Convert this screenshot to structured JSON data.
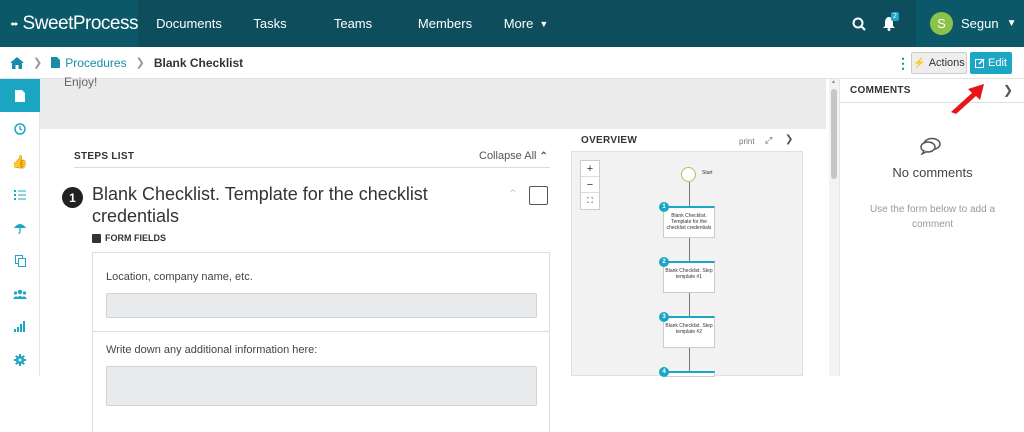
{
  "brand": {
    "name": "SweetProcess"
  },
  "nav": {
    "items": [
      {
        "label": "Documents"
      },
      {
        "label": "Tasks"
      },
      {
        "label": "Teams"
      },
      {
        "label": "Members"
      },
      {
        "label": "More"
      }
    ],
    "notification_count": "2",
    "user": {
      "initial": "S",
      "name": "Segun"
    }
  },
  "breadcrumb": {
    "items": [
      {
        "label": "Procedures"
      },
      {
        "label": "Blank Checklist"
      }
    ]
  },
  "toolbar": {
    "actions_label": "Actions",
    "edit_label": "Edit"
  },
  "content": {
    "intro_text": "Enjoy!"
  },
  "steps": {
    "header": "STEPS LIST",
    "collapse_label": "Collapse All",
    "step1": {
      "number": "1",
      "title": "Blank Checklist. Template for the checklist credentials",
      "form_fields_label": "FORM FIELDS",
      "fields": [
        {
          "label": "Location, company name, etc."
        },
        {
          "label": "Write down any additional information here:"
        }
      ]
    }
  },
  "overview": {
    "title": "OVERVIEW",
    "print_label": "print",
    "start_label": "Start",
    "nodes": [
      {
        "num": "1",
        "text": "Blank Checklist. Template for the checklist credentials"
      },
      {
        "num": "2",
        "text": "Blank Checklist. Step template #1"
      },
      {
        "num": "3",
        "text": "Blank Checklist. Step template #2"
      },
      {
        "num": "4",
        "text": ""
      }
    ]
  },
  "comments": {
    "header": "COMMENTS",
    "empty_title": "No comments",
    "hint": "Use the form below to add a comment"
  },
  "colors": {
    "topbar": "#0e4d5c",
    "accent": "#1ba6c4",
    "arrow": "#e8141b",
    "avatar": "#8bc34a"
  }
}
